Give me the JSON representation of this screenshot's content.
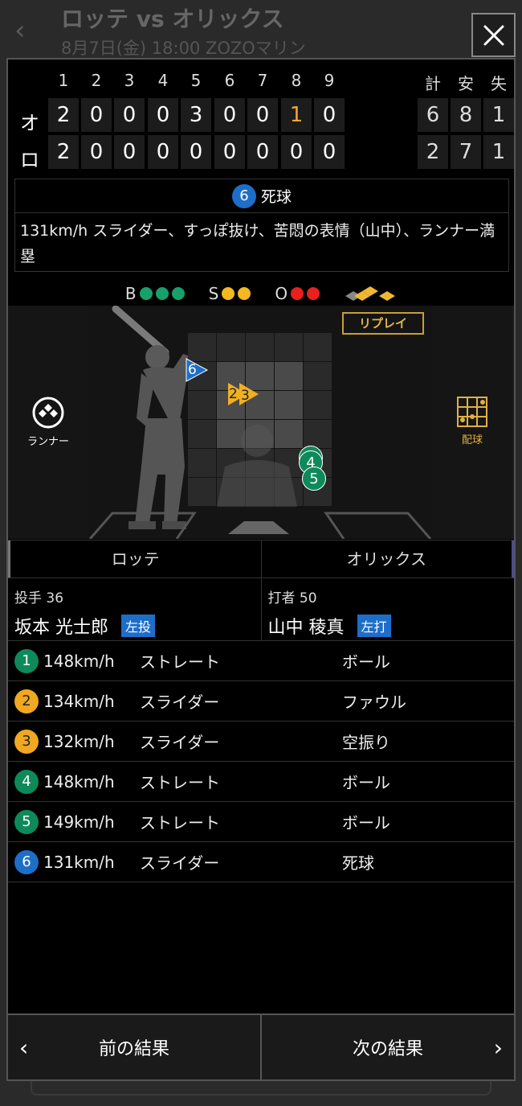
{
  "bg": {
    "title": "ロッテ vs オリックス",
    "subtitle": "8月7日(金) 18:00 ZOZOマリン",
    "back_icon": "chevron-left-icon",
    "close_icon": "close-icon"
  },
  "scoreboard": {
    "innings": [
      "1",
      "2",
      "3",
      "4",
      "5",
      "6",
      "7",
      "8",
      "9"
    ],
    "totals_headers": [
      "計",
      "安",
      "失"
    ],
    "rows": [
      {
        "team": "オ",
        "scores": [
          "2",
          "0",
          "0",
          "0",
          "3",
          "0",
          "0",
          "1",
          "0"
        ],
        "totals": [
          "6",
          "8",
          "1"
        ],
        "highlight_index": 7
      },
      {
        "team": "ロ",
        "scores": [
          "2",
          "0",
          "0",
          "0",
          "0",
          "0",
          "0",
          "0",
          "0"
        ],
        "totals": [
          "2",
          "7",
          "1"
        ]
      }
    ],
    "highlight_color": "#f0a830"
  },
  "play": {
    "number": "6",
    "result": "死球",
    "description": "131km/h スライダー、すっぽ抜け、苦悶の表情（山中）、ランナー満塁"
  },
  "count": {
    "b_label": "B",
    "s_label": "S",
    "o_label": "O",
    "balls": 3,
    "strikes": 2,
    "outs": 2
  },
  "field": {
    "runner_label": "ランナー",
    "pitch_chart_label": "配球",
    "replay_label": "リプレイ",
    "markers": [
      "6",
      "2",
      "3",
      "4",
      "5"
    ]
  },
  "teams": {
    "left": "ロッテ",
    "right": "オリックス"
  },
  "pitcher": {
    "role": "投手",
    "number": "36",
    "name": "坂本 光士郎",
    "hand": "左投"
  },
  "batter": {
    "role": "打者",
    "number": "50",
    "name": "山中 稜真",
    "hand": "左打"
  },
  "pitches": [
    {
      "no": "1",
      "speed": "148km/h",
      "type": "ストレート",
      "result": "ボール",
      "color": "green"
    },
    {
      "no": "2",
      "speed": "134km/h",
      "type": "スライダー",
      "result": "ファウル",
      "color": "yellow"
    },
    {
      "no": "3",
      "speed": "132km/h",
      "type": "スライダー",
      "result": "空振り",
      "color": "yellow"
    },
    {
      "no": "4",
      "speed": "148km/h",
      "type": "ストレート",
      "result": "ボール",
      "color": "green"
    },
    {
      "no": "5",
      "speed": "149km/h",
      "type": "ストレート",
      "result": "ボール",
      "color": "green"
    },
    {
      "no": "6",
      "speed": "131km/h",
      "type": "スライダー",
      "result": "死球",
      "color": "blue"
    }
  ],
  "footer": {
    "prev": "前の結果",
    "next": "次の結果"
  }
}
